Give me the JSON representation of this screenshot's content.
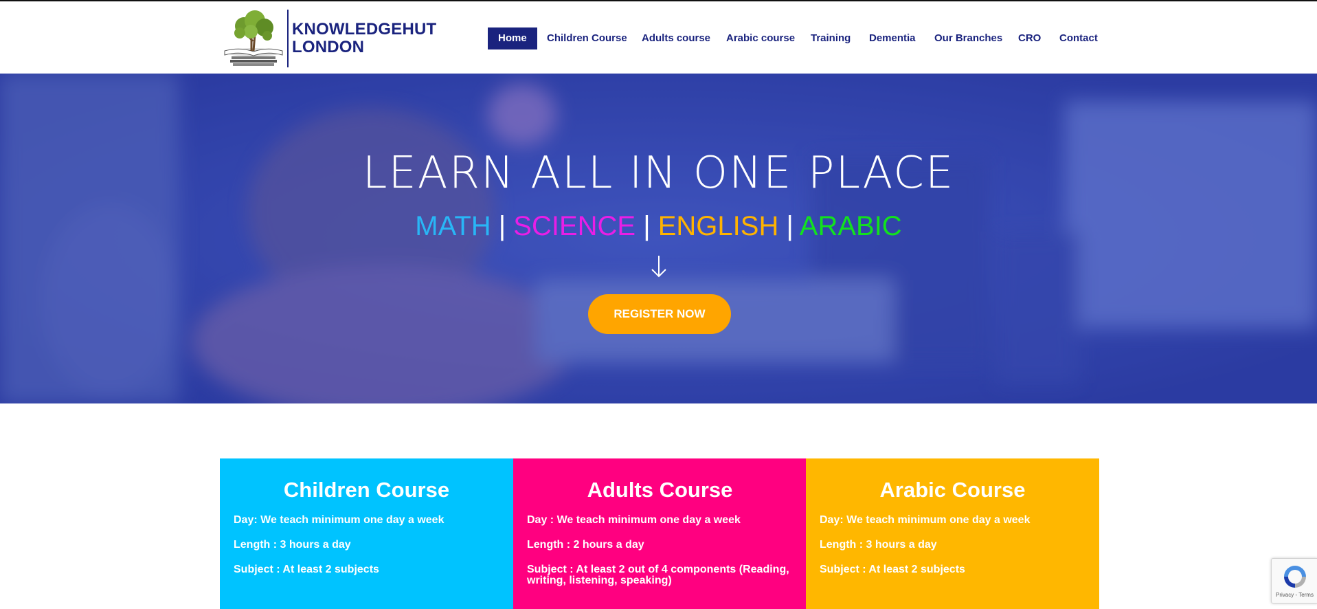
{
  "brand": {
    "line1": "KNOWLEDGEHUT",
    "line2": "LONDON",
    "color": "#1a237e"
  },
  "nav": {
    "items": [
      {
        "label": "Home",
        "active": true
      },
      {
        "label": "Children Course"
      },
      {
        "label": "Adults course"
      },
      {
        "label": "Arabic course"
      },
      {
        "label": "Training"
      },
      {
        "label": "Dementia"
      },
      {
        "label": "Our Branches"
      },
      {
        "label": "CRO"
      },
      {
        "label": "Contact"
      }
    ]
  },
  "hero": {
    "title": "LEARN ALL IN ONE PLACE",
    "subjects": [
      {
        "label": "MATH",
        "color": "#29b6f6"
      },
      {
        "label": "SCIENCE",
        "color": "#e91ee6"
      },
      {
        "label": "ENGLISH",
        "color": "#ffb300"
      },
      {
        "label": "ARABIC",
        "color": "#12e21e"
      }
    ],
    "separator": "|",
    "arrow_icon": "arrow-down-icon",
    "cta": "REGISTER NOW",
    "cta_color": "#ffa500",
    "overlay_color": "#2a3fb5"
  },
  "cards": [
    {
      "title": "Children Course",
      "color": "#00c3ff",
      "lines": [
        "Day: We teach minimum one day a week",
        "Length : 3 hours a day",
        "Subject : At least 2 subjects"
      ]
    },
    {
      "title": "Adults Course",
      "color": "#ff0080",
      "lines": [
        "Day : We teach minimum one day a week",
        "Length : 2 hours a day",
        "Subject : At least 2 out of 4 components (Reading, writing, listening, speaking)"
      ]
    },
    {
      "title": "Arabic Course",
      "color": "#ffb700",
      "lines": [
        "Day: We teach minimum one day a week",
        "Length : 3 hours a day",
        "Subject : At least 2 subjects"
      ]
    }
  ],
  "recaptcha": {
    "links": "Privacy - Terms",
    "icon": "recaptcha-icon"
  }
}
